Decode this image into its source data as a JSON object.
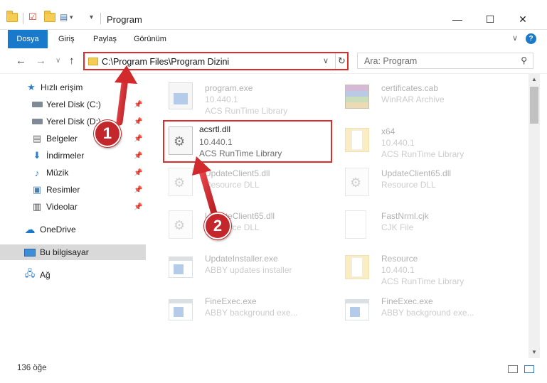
{
  "window": {
    "title": "Program",
    "minimize_glyph": "—",
    "maximize_glyph": "☐",
    "close_glyph": "✕"
  },
  "ribbon": {
    "tabs": [
      "Dosya",
      "Giriş",
      "Paylaş",
      "Görünüm"
    ],
    "help_glyph": "?",
    "collapse_glyph": "∨",
    "accent_color": "#1979ca"
  },
  "address": {
    "path": "C:\\Program Files\\Program Dizini",
    "dropdown_glyph": "∨",
    "refresh_glyph": "↻"
  },
  "search": {
    "placeholder": "Ara: Program",
    "icon": "search-icon"
  },
  "nav": {
    "back_glyph": "←",
    "forward_glyph": "→",
    "recent_glyph": "∨",
    "up_glyph": "↑",
    "items": [
      {
        "label": "Hızlı erişim",
        "icon": "star-icon"
      },
      {
        "label": "Yerel Disk (C:)",
        "icon": "drive-icon"
      },
      {
        "label": "Yerel Disk (D:)",
        "icon": "drive-icon"
      },
      {
        "label": "Belgeler",
        "icon": "documents-icon"
      },
      {
        "label": "İndirmeler",
        "icon": "downloads-icon"
      },
      {
        "label": "Müzik",
        "icon": "music-icon"
      },
      {
        "label": "Resimler",
        "icon": "pictures-icon"
      },
      {
        "label": "Videolar",
        "icon": "videos-icon"
      },
      {
        "label": "OneDrive",
        "icon": "cloud-icon"
      },
      {
        "label": "Bu bilgisayar",
        "icon": "computer-icon"
      },
      {
        "label": "Ağ",
        "icon": "network-icon"
      }
    ]
  },
  "files": [
    {
      "name": "program.exe",
      "line2": "10.440.1",
      "line3": "ACS RunTime Library",
      "icon": "program-icon"
    },
    {
      "name": "certificates.cab",
      "line2": "WinRAR Archive",
      "line3": "",
      "icon": "archive-icon"
    },
    {
      "name": "acsrtl.dll",
      "line2": "10.440.1",
      "line3": "ACS RunTime Library",
      "icon": "dll-icon"
    },
    {
      "name": "x64",
      "line2": "10.440.1",
      "line3": "ACS RunTime Library",
      "icon": "folder-icon"
    },
    {
      "name": "UpdateClient5.dll",
      "line2": "Resource DLL",
      "line3": "",
      "icon": "dll-icon"
    },
    {
      "name": "UpdateClient65.dll",
      "line2": "Resource DLL",
      "line3": "",
      "icon": "dll-icon"
    },
    {
      "name": "UpdateClient65.dll",
      "line2": "Resource DLL",
      "line3": "",
      "icon": "dll-icon"
    },
    {
      "name": "FastNrml.cjk",
      "line2": "CJK File",
      "line3": "",
      "icon": "file-icon"
    },
    {
      "name": "UpdateInstaller.exe",
      "line2": "ABBY updates installer",
      "line3": "",
      "icon": "exe-icon"
    },
    {
      "name": "Resource",
      "line2": "10.440.1",
      "line3": "ACS RunTime Library",
      "icon": "folder-icon"
    },
    {
      "name": "FineExec.exe",
      "line2": "ABBY background exe...",
      "line3": "",
      "icon": "exe-icon"
    },
    {
      "name": "FineExec.exe",
      "line2": "ABBY background exe...",
      "line3": "",
      "icon": "exe-icon"
    }
  ],
  "status": {
    "count": "136 öğe"
  },
  "annotations": {
    "step1": "1",
    "step2": "2",
    "highlight_color": "#e02b2b"
  }
}
